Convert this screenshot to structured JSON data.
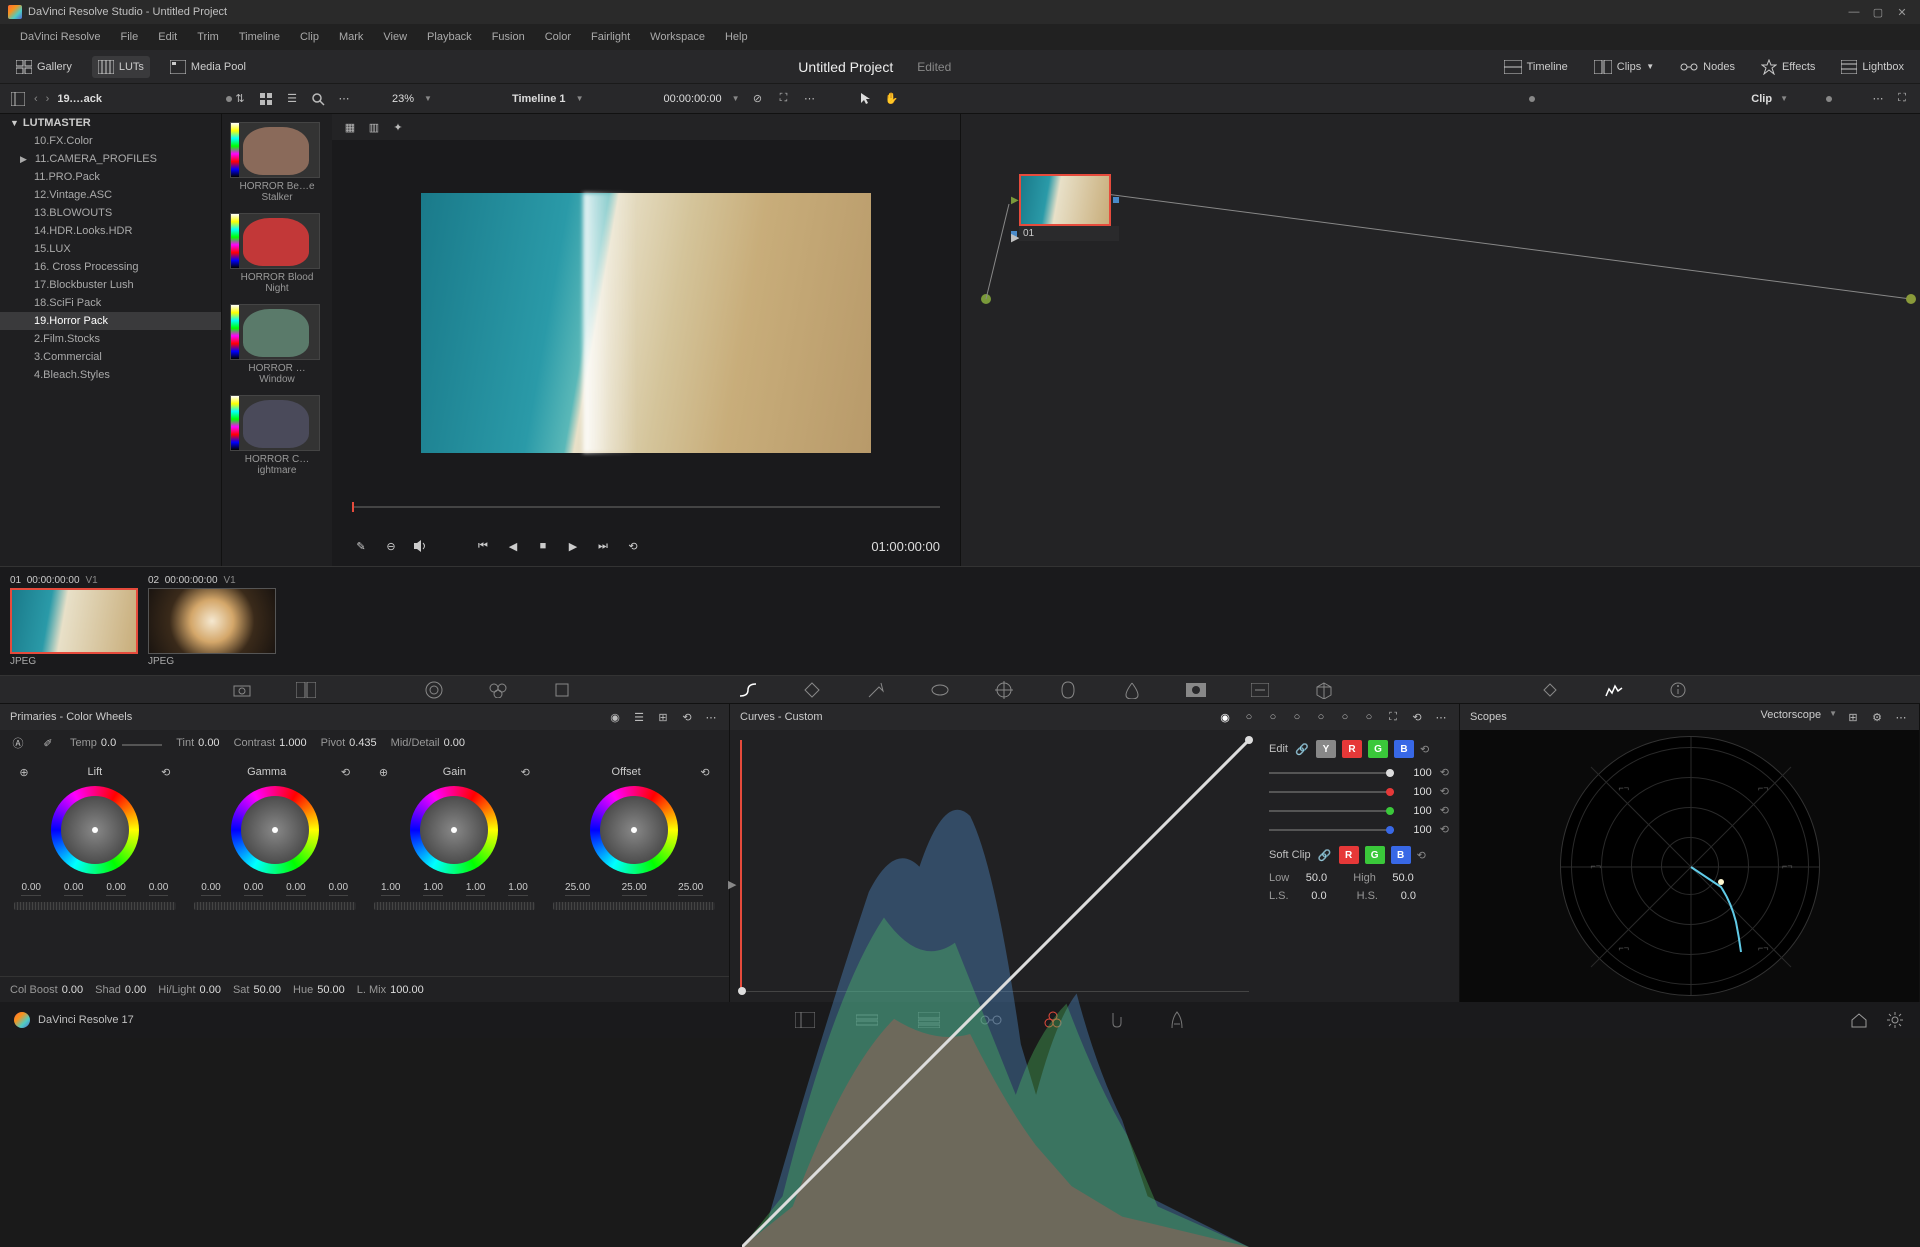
{
  "titlebar": {
    "text": "DaVinci Resolve Studio - Untitled Project"
  },
  "menu": [
    "DaVinci Resolve",
    "File",
    "Edit",
    "Trim",
    "Timeline",
    "Clip",
    "Mark",
    "View",
    "Playback",
    "Fusion",
    "Color",
    "Fairlight",
    "Workspace",
    "Help"
  ],
  "toolbar": {
    "gallery": "Gallery",
    "luts": "LUTs",
    "mediapool": "Media Pool",
    "project_title": "Untitled Project",
    "edited": "Edited",
    "timeline": "Timeline",
    "clips": "Clips",
    "nodes": "Nodes",
    "effects": "Effects",
    "lightbox": "Lightbox"
  },
  "secbar": {
    "breadcrumb": "19.…ack",
    "zoom": "23%",
    "timeline_name": "Timeline 1",
    "src_timecode": "00:00:00:00",
    "clip_label": "Clip"
  },
  "luts_tree": {
    "header": "LUTMASTER",
    "items": [
      {
        "label": "10.FX.Color"
      },
      {
        "label": "11.CAMERA_PROFILES",
        "expandable": true
      },
      {
        "label": "11.PRO.Pack"
      },
      {
        "label": "12.Vintage.ASC"
      },
      {
        "label": "13.BLOWOUTS"
      },
      {
        "label": "14.HDR.Looks.HDR"
      },
      {
        "label": "15.LUX"
      },
      {
        "label": "16. Cross Processing"
      },
      {
        "label": "17.Blockbuster Lush"
      },
      {
        "label": "18.SciFi Pack"
      },
      {
        "label": "19.Horror Pack",
        "selected": true
      },
      {
        "label": "2.Film.Stocks"
      },
      {
        "label": "3.Commercial"
      },
      {
        "label": "4.Bleach.Styles"
      }
    ]
  },
  "lut_thumbs": [
    {
      "name": "HORROR Be…e Stalker",
      "tint": "#8a6a5a"
    },
    {
      "name": "HORROR Blood Night",
      "tint": "#c23838"
    },
    {
      "name": "HORROR … Window",
      "tint": "#5a7a6a"
    },
    {
      "name": "HORROR C…ightmare",
      "tint": "#4a4a5a"
    }
  ],
  "viewer": {
    "timecode": "01:00:00:00"
  },
  "node": {
    "label": "01"
  },
  "clips": [
    {
      "num": "01",
      "tc": "00:00:00:00",
      "track": "V1",
      "type": "JPEG",
      "active": true,
      "variant": "beach"
    },
    {
      "num": "02",
      "tc": "00:00:00:00",
      "track": "V1",
      "type": "JPEG",
      "active": false,
      "variant": "coffee"
    }
  ],
  "primaries": {
    "title": "Primaries - Color Wheels",
    "top": {
      "temp_label": "Temp",
      "temp": "0.0",
      "tint_label": "Tint",
      "tint": "0.00",
      "contrast_label": "Contrast",
      "contrast": "1.000",
      "pivot_label": "Pivot",
      "pivot": "0.435",
      "md_label": "Mid/Detail",
      "md": "0.00"
    },
    "wheels": [
      {
        "name": "Lift",
        "vals": [
          "0.00",
          "0.00",
          "0.00",
          "0.00"
        ]
      },
      {
        "name": "Gamma",
        "vals": [
          "0.00",
          "0.00",
          "0.00",
          "0.00"
        ]
      },
      {
        "name": "Gain",
        "vals": [
          "1.00",
          "1.00",
          "1.00",
          "1.00"
        ]
      },
      {
        "name": "Offset",
        "vals": [
          "25.00",
          "25.00",
          "25.00"
        ]
      }
    ],
    "bottom": {
      "colboost_label": "Col Boost",
      "colboost": "0.00",
      "shad_label": "Shad",
      "shad": "0.00",
      "hilight_label": "Hi/Light",
      "hilight": "0.00",
      "sat_label": "Sat",
      "sat": "50.00",
      "hue_label": "Hue",
      "hue": "50.00",
      "lmix_label": "L. Mix",
      "lmix": "100.00"
    }
  },
  "curves": {
    "title": "Curves - Custom",
    "edit_label": "Edit",
    "channels": {
      "y": "100",
      "r": "100",
      "g": "100",
      "b": "100"
    },
    "softclip_label": "Soft Clip",
    "low_label": "Low",
    "low": "50.0",
    "high_label": "High",
    "high": "50.0",
    "ls_label": "L.S.",
    "ls": "0.0",
    "hs_label": "H.S.",
    "hs": "0.0"
  },
  "scopes": {
    "title": "Scopes",
    "type": "Vectorscope"
  },
  "bottombar": {
    "version": "DaVinci Resolve 17"
  }
}
